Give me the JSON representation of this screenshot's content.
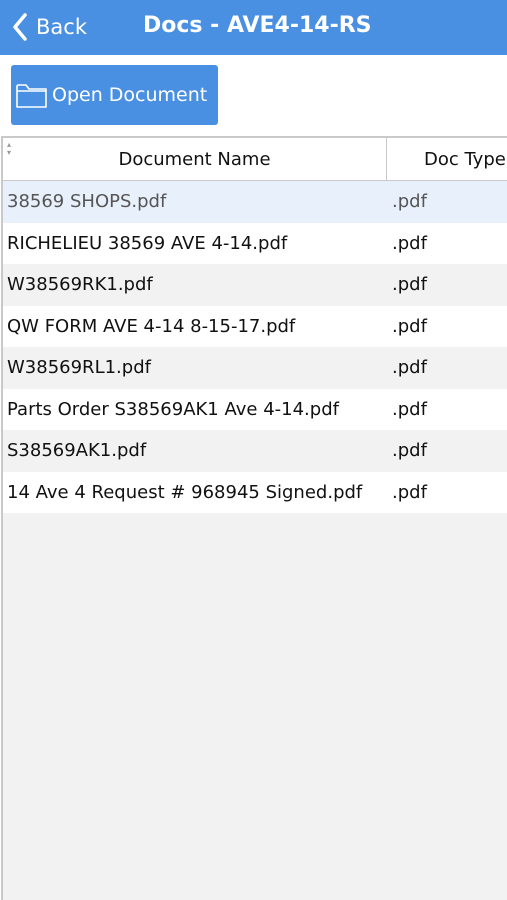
{
  "nav": {
    "back_label": "Back",
    "title": "Docs - AVE4-14-RS",
    "color": "#4a90e2"
  },
  "toolbar": {
    "open_document_label": "Open Document",
    "open_document_icon": "folder-icon"
  },
  "grid": {
    "columns": [
      "Document Name",
      "Doc Type"
    ],
    "rows": [
      {
        "name": "38569 SHOPS.pdf",
        "type": ".pdf",
        "selected": true
      },
      {
        "name": "RICHELIEU 38569 AVE 4-14.pdf",
        "type": ".pdf"
      },
      {
        "name": "W38569RK1.pdf",
        "type": ".pdf"
      },
      {
        "name": "QW FORM AVE 4-14 8-15-17.pdf",
        "type": ".pdf"
      },
      {
        "name": "W38569RL1.pdf",
        "type": ".pdf"
      },
      {
        "name": "Parts Order S38569AK1 Ave 4-14.pdf",
        "type": ".pdf"
      },
      {
        "name": "S38569AK1.pdf",
        "type": ".pdf"
      },
      {
        "name": "14 Ave 4 Request # 968945 Signed.pdf",
        "type": ".pdf"
      }
    ]
  }
}
